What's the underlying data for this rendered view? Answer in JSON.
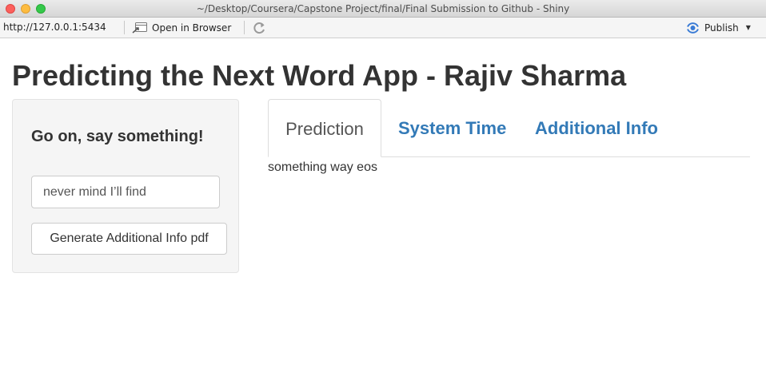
{
  "window": {
    "title": "~/Desktop/Coursera/Capstone Project/final/Final Submission to Github - Shiny"
  },
  "toolbar": {
    "url": "http://127.0.0.1:5434",
    "open_browser_label": "Open in Browser",
    "publish_label": "Publish"
  },
  "app": {
    "title": "Predicting the Next Word App - Rajiv Sharma",
    "sidebar": {
      "heading": "Go on, say something!",
      "input_value": "never mind I’ll find",
      "button_label": "Generate Additional Info pdf"
    },
    "tabs": [
      {
        "label": "Prediction",
        "active": true
      },
      {
        "label": "System Time",
        "active": false
      },
      {
        "label": "Additional Info",
        "active": false
      }
    ],
    "prediction_output": "something way eos"
  },
  "colors": {
    "link": "#337ab7",
    "publish_icon": "#3a7bd5",
    "close": "#fc605c",
    "minimize": "#fdbc40",
    "maximize": "#34c84a"
  }
}
